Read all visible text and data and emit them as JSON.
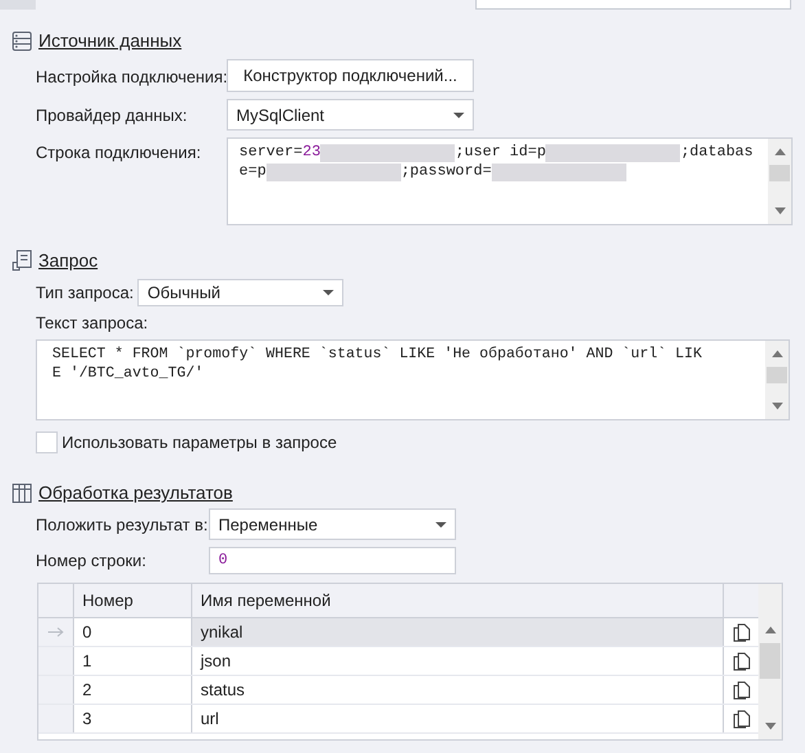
{
  "source": {
    "title": "Источник данных",
    "connection_setup": {
      "label": "Настройка подключения:",
      "button": "Конструктор подключений..."
    },
    "provider": {
      "label": "Провайдер данных:",
      "value": "MySqlClient"
    },
    "connection_string": {
      "label": "Строка подключения:",
      "lines": [
        [
          {
            "kind": "text",
            "text": "server="
          },
          {
            "kind": "number",
            "text": "23"
          },
          {
            "kind": "redacted"
          },
          {
            "kind": "text",
            "text": ";user id=p"
          },
          {
            "kind": "redacted"
          },
          {
            "kind": "text",
            "text": ";databas"
          }
        ],
        [
          {
            "kind": "text",
            "text": "e=p"
          },
          {
            "kind": "redacted"
          },
          {
            "kind": "text",
            "text": ";password="
          },
          {
            "kind": "redacted"
          }
        ]
      ]
    }
  },
  "query": {
    "title": "Запрос",
    "type": {
      "label": "Тип запроса:",
      "value": "Обычный"
    },
    "text": {
      "label": "Текст запроса:",
      "lines": [
        "SELECT * FROM `promofy` WHERE `status` LIKE 'Не обработано' AND `url` LIK",
        "E '/BTC_avto_TG/'"
      ]
    },
    "use_params": {
      "label": "Использовать параметры в запросе",
      "checked": false
    }
  },
  "results": {
    "title": "Обработка результатов",
    "put_into": {
      "label": "Положить результат в:",
      "value": "Переменные"
    },
    "row_number": {
      "label": "Номер строки:",
      "value": "0"
    },
    "table": {
      "columns": [
        "Номер",
        "Имя переменной"
      ],
      "rows": [
        {
          "number": "0",
          "name": "ynikal",
          "selected": true
        },
        {
          "number": "1",
          "name": "json",
          "selected": false
        },
        {
          "number": "2",
          "name": "status",
          "selected": false
        },
        {
          "number": "3",
          "name": "url",
          "selected": false
        }
      ]
    }
  }
}
